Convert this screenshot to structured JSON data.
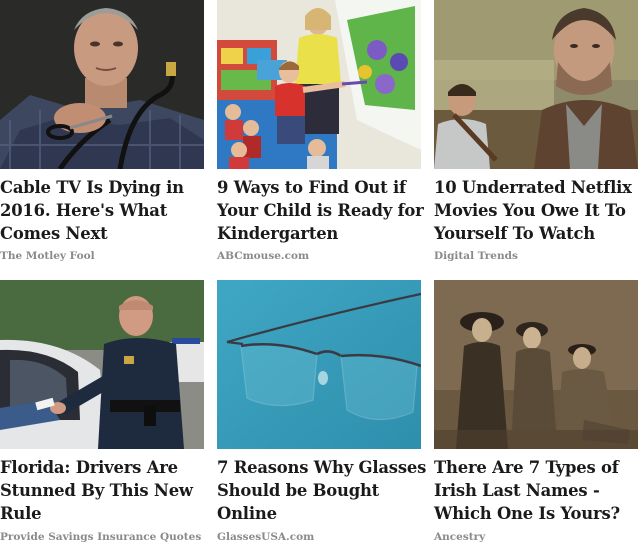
{
  "cards": [
    {
      "headline": "Cable TV Is Dying in 2016. Here's What Comes Next",
      "source": "The Motley Fool",
      "image": "man-cutting-cable-photo"
    },
    {
      "headline": "9 Ways to Find Out if Your Child is Ready for Kindergarten",
      "source": "ABCmouse.com",
      "image": "classroom-children-whiteboard-photo"
    },
    {
      "headline": "10 Underrated Netflix Movies You Owe It To Yourself To Watch",
      "source": "Digital Trends",
      "image": "movie-still-bearded-man-boy-photo"
    },
    {
      "headline": "Florida: Drivers Are Stunned By This New Rule",
      "source": "Provide Savings Insurance Quotes",
      "image": "police-officer-traffic-stop-photo"
    },
    {
      "headline": "7 Reasons Why Glasses Should be Bought Online",
      "source": "GlassesUSA.com",
      "image": "eyeglasses-blue-background-photo"
    },
    {
      "headline": "There Are 7 Types of Irish Last Names - Which One Is Yours?",
      "source": "Ancestry",
      "image": "vintage-family-portrait-photo"
    }
  ],
  "colors": {
    "headline": "#1a1a1a",
    "source": "#8a8a8a",
    "background": "#ffffff"
  }
}
